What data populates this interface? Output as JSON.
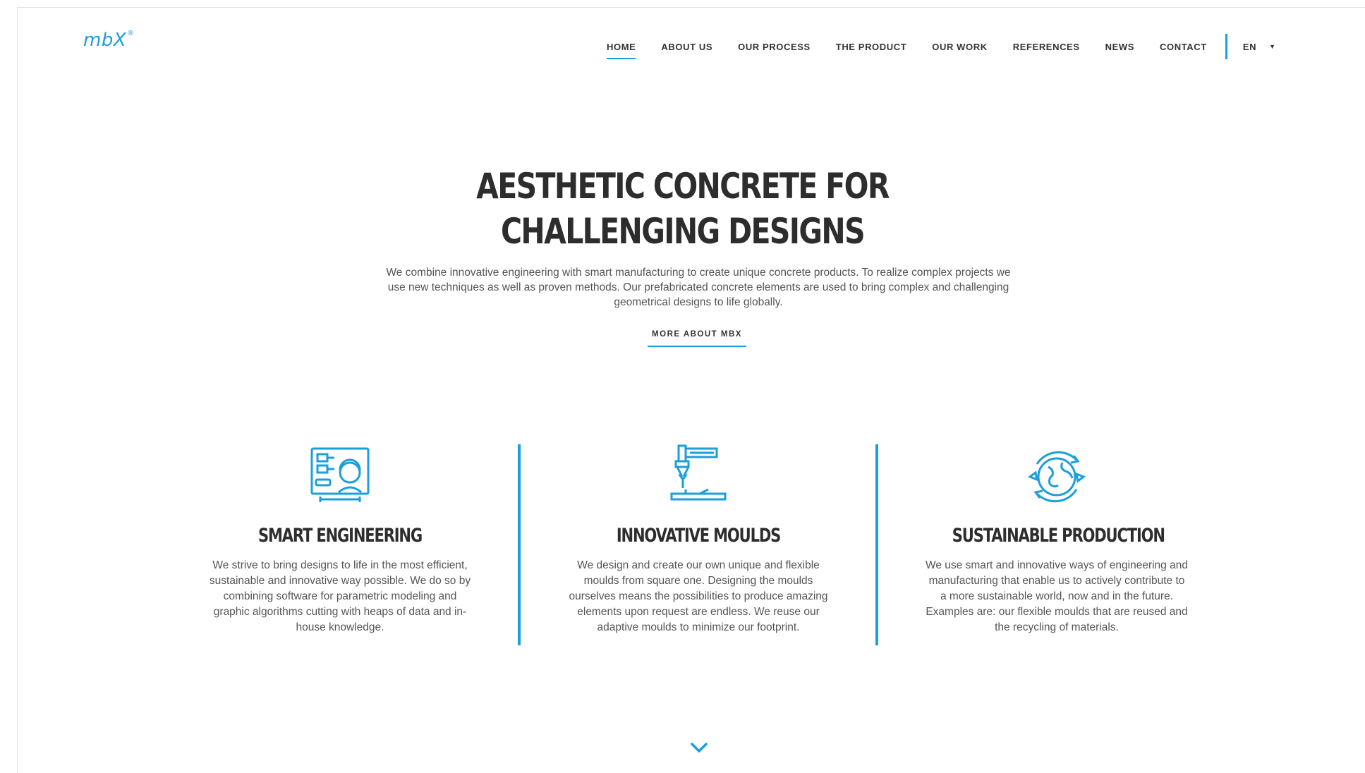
{
  "brand": {
    "logo": "mbX",
    "logo_mark": "®",
    "accent_color": "#1a9fd9"
  },
  "nav": {
    "items": [
      {
        "label": "HOME",
        "active": true
      },
      {
        "label": "ABOUT US"
      },
      {
        "label": "OUR PROCESS"
      },
      {
        "label": "THE PRODUCT"
      },
      {
        "label": "OUR WORK"
      },
      {
        "label": "REFERENCES"
      },
      {
        "label": "NEWS"
      },
      {
        "label": "CONTACT"
      }
    ],
    "language": "EN"
  },
  "hero": {
    "title_line1": "AESTHETIC CONCRETE FOR",
    "title_line2": "CHALLENGING DESIGNS",
    "text": "We combine innovative engineering with smart manufacturing to create unique concrete products. To realize complex projects we use new techniques as well as proven methods. Our prefabricated concrete elements are used to bring complex and challenging geometrical designs to life globally.",
    "more_link": "MORE ABOUT MBX"
  },
  "features": [
    {
      "icon": "engineering-screen-icon",
      "title": "SMART ENGINEERING",
      "text": "We strive to bring designs to life in the most efficient, sustainable and innovative way possible. We do so by combining software for parametric modeling and graphic algorithms cutting with heaps of data and in-house knowledge."
    },
    {
      "icon": "robot-arm-icon",
      "title": "INNOVATIVE MOULDS",
      "text": "We design and create our own unique and flexible moulds from square one. Designing the moulds ourselves means the possibilities to produce amazing elements upon request are endless. We reuse our adaptive moulds to minimize our footprint."
    },
    {
      "icon": "recycle-globe-icon",
      "title": "SUSTAINABLE PRODUCTION",
      "text": "We use smart and innovative ways of engineering and manufacturing that enable us to actively contribute to a more sustainable world, now and in the future. Examples are: our flexible moulds that are reused and the recycling of materials."
    }
  ],
  "scroll_icon": "chevron-down-icon"
}
